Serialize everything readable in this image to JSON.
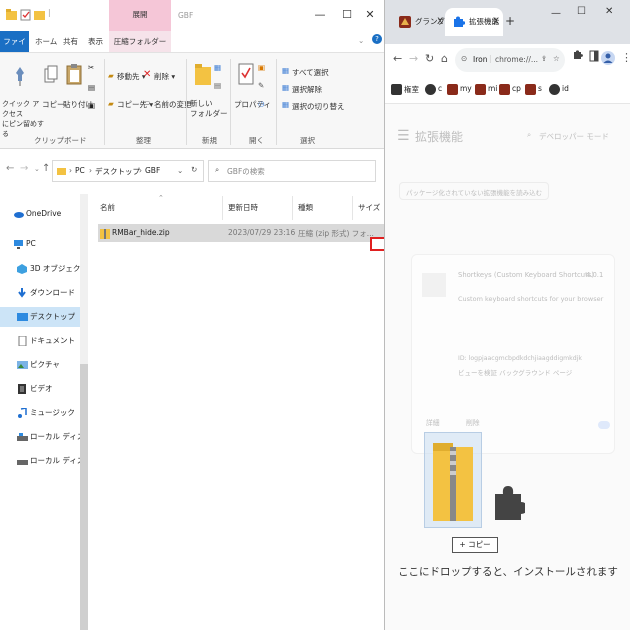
{
  "explorer": {
    "ribbon_tabs": [
      "ファイル",
      "ホーム",
      "共有",
      "表示",
      "圧縮フォルダー ツール"
    ],
    "context_tab": "展開",
    "window_title": "GBF",
    "window_controls": {
      "minimize": "—",
      "maximize": "☐",
      "close": "✕"
    },
    "ribbon": {
      "clipboard": {
        "pin_label": "クイック アクセス\nにピン留めする",
        "copy_label": "コピー",
        "paste_label": "貼り付け",
        "group": "クリップボード"
      },
      "organize": {
        "move_label": "移動先",
        "copy_to_label": "コピー先",
        "delete_label": "削除",
        "rename_label": "名前の変更",
        "group": "整理"
      },
      "new": {
        "new_folder_label": "新しい\nフォルダー",
        "group": "新規"
      },
      "open": {
        "properties_label": "プロパティ",
        "group": "開く"
      },
      "select": {
        "select_all": "すべて選択",
        "select_none": "選択解除",
        "invert": "選択の切り替え",
        "group": "選択"
      }
    },
    "breadcrumb": [
      "PC",
      "デスクトップ",
      "GBF"
    ],
    "search_placeholder": "GBFの検索",
    "nav": [
      {
        "label": "OneDrive",
        "icon": "cloud-icon"
      },
      {
        "label": "PC",
        "icon": "pc-icon"
      },
      {
        "label": "3D オブジェクト",
        "icon": "3d-objects-icon"
      },
      {
        "label": "ダウンロード",
        "icon": "download-icon"
      },
      {
        "label": "デスクトップ",
        "icon": "desktop-icon",
        "selected": true
      },
      {
        "label": "ドキュメント",
        "icon": "document-icon"
      },
      {
        "label": "ピクチャ",
        "icon": "pictures-icon"
      },
      {
        "label": "ビデオ",
        "icon": "video-icon"
      },
      {
        "label": "ミュージック",
        "icon": "music-icon"
      },
      {
        "label": "ローカル ディスク (C:)",
        "icon": "drive-icon"
      },
      {
        "label": "ローカル ディスク (D:)",
        "icon": "drive-icon"
      }
    ],
    "columns": {
      "name": "名前",
      "date": "更新日時",
      "type": "種類",
      "size": "サイズ"
    },
    "files": [
      {
        "name": "RMBar_hide.zip",
        "date": "2023/07/29 23:16",
        "type": "圧縮 (zip 形式) フォ..."
      }
    ]
  },
  "chrome": {
    "tabs": [
      {
        "title": "グランブル",
        "close": "X"
      },
      {
        "title": "拡張機能",
        "close": "X",
        "active": true
      }
    ],
    "new_tab": "+",
    "window_controls": {
      "minimize": "—",
      "maximize": "☐",
      "close": "✕"
    },
    "omnibox": {
      "site": "Iron",
      "url": "chrome://..."
    },
    "bookmarks": [
      "権室",
      "c",
      "my",
      "mi",
      "cp",
      "s",
      "id"
    ],
    "page": {
      "title": "拡張機能",
      "dev_mode": "デベロッパー モード",
      "load_unpacked": "パッケージ化されていない拡張機能を読み込む",
      "card": {
        "name": "Shortkeys (Custom Keyboard Shortcuts)",
        "version": "4.0.1",
        "desc": "Custom keyboard shortcuts for your browser",
        "id_line": "ID: logpjaacgmcbpdkdchjiaagddigmkdjk",
        "views": "ビューを検証 バックグラウンド ページ",
        "details": "詳細",
        "remove": "削除"
      },
      "drop_text": "ここにドロップすると、インストールされます"
    }
  },
  "drag": {
    "copy_label": "+ コピー"
  },
  "colors": {
    "file_tab": "#1a6fc4",
    "context_tab": "#f5c6d7",
    "selection": "#cce4f7",
    "arrow": "#e02020",
    "chrome_frame": "#dee1e6"
  }
}
